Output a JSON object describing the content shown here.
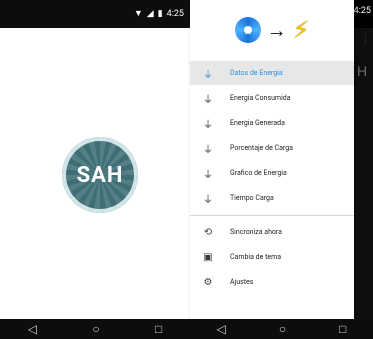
{
  "left_screen": {
    "status": {
      "time": "4:25",
      "wifi_icon": "wifi-icon",
      "signal_icon": "signal-icon",
      "battery_icon": "battery-icon"
    },
    "logo_text": "SAH",
    "nav": {
      "back": "◁",
      "home": "○",
      "recents": "□"
    }
  },
  "right_screen": {
    "status": {
      "time": "4:25"
    },
    "background_letter": "H",
    "drawer": {
      "header_icons": [
        "swirl-logo-icon",
        "arrow-right-icon",
        "lightning-bolt-icon"
      ],
      "items": [
        {
          "label": "Datos de Energia",
          "icon": "plug-icon",
          "active": true
        },
        {
          "label": "Energia Consumida",
          "icon": "plug-icon",
          "active": false
        },
        {
          "label": "Energia Generada",
          "icon": "plug-icon",
          "active": false
        },
        {
          "label": "Porcentaje de Carga",
          "icon": "plug-icon",
          "active": false
        },
        {
          "label": "Grafico de Energia",
          "icon": "plug-icon",
          "active": false
        },
        {
          "label": "Tiempo Carga",
          "icon": "plug-icon",
          "active": false
        }
      ],
      "secondary_items": [
        {
          "label": "Sincroniza ahora",
          "icon": "sync-icon"
        },
        {
          "label": "Cambia de tema",
          "icon": "briefcase-icon"
        },
        {
          "label": "Ajustes",
          "icon": "gear-icon"
        }
      ]
    },
    "nav": {
      "back": "◁",
      "home": "○",
      "recents": "□"
    }
  },
  "colors": {
    "active_accent": "#2a92e0",
    "logo_bg": "#3e6d75",
    "bolt": "#f2c200"
  }
}
